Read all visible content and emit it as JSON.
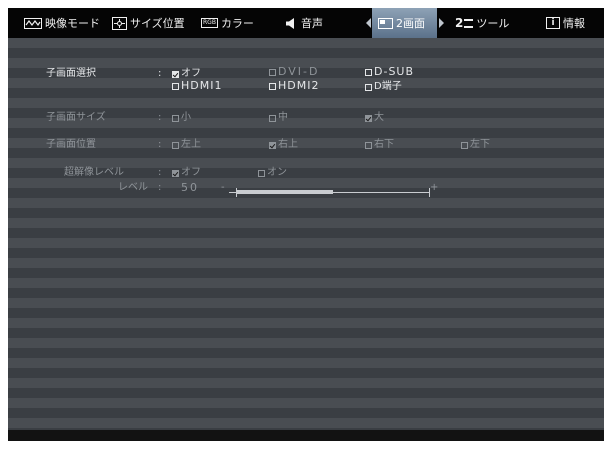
{
  "tabs": [
    {
      "label": "映像モード",
      "icon": "wave-icon"
    },
    {
      "label": "サイズ位置",
      "icon": "position-icon"
    },
    {
      "label": "カラー",
      "icon": "rgb-icon",
      "badge": "RGB"
    },
    {
      "label": "音声",
      "icon": "speaker-icon"
    },
    {
      "label": "2画面",
      "icon": "dual-screen-icon",
      "active": true
    },
    {
      "label": "ツール",
      "icon": "tool-icon",
      "glyph": "2"
    },
    {
      "label": "情報",
      "icon": "info-icon",
      "glyph": "i"
    }
  ],
  "rows": {
    "sub_select": {
      "label": "子画面選択",
      "colon": ":",
      "options": [
        "オフ",
        "DVI-D",
        "D-SUB",
        "HDMI1",
        "HDMI2",
        "D端子"
      ],
      "selected": "オフ"
    },
    "sub_size": {
      "label": "子画面サイズ",
      "colon": ":",
      "options": [
        "小",
        "中",
        "大"
      ],
      "selected": "大"
    },
    "sub_position": {
      "label": "子画面位置",
      "colon": ":",
      "options": [
        "左上",
        "右上",
        "右下",
        "左下"
      ],
      "selected": "右上"
    },
    "super_res": {
      "label": "超解像レベル",
      "colon": ":",
      "options": [
        "オフ",
        "オン"
      ],
      "selected": "オフ"
    },
    "level": {
      "label": "レベル",
      "colon": ":",
      "value": "50",
      "minus": "-",
      "plus": "+",
      "fraction": 0.5
    }
  },
  "colors": {
    "panel": "#494d52",
    "stripe": "#3a3e43",
    "active_tab": "#6f8398",
    "text": "#e4e6e8",
    "disabled_text": "#8f9499"
  }
}
